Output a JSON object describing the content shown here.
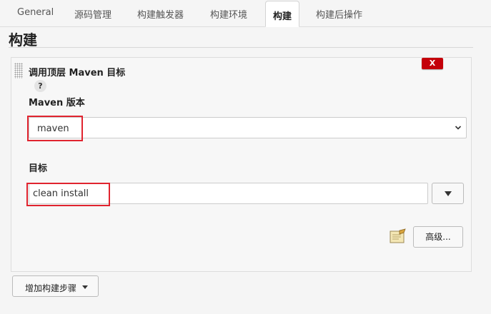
{
  "tabs": [
    {
      "label": "General"
    },
    {
      "label": "源码管理"
    },
    {
      "label": "构建触发器"
    },
    {
      "label": "构建环境"
    },
    {
      "label": "构建",
      "active": true
    },
    {
      "label": "构建后操作"
    }
  ],
  "section": {
    "title": "构建"
  },
  "build_step": {
    "title": "调用顶层 Maven 目标",
    "delete_label": "X",
    "help_label": "?",
    "maven_version": {
      "label": "Maven 版本",
      "selected": "maven"
    },
    "goals": {
      "label": "目标",
      "value": "clean install"
    },
    "advanced_label": "高级..."
  },
  "add_step_label": "增加构建步骤",
  "colors": {
    "delete_red": "#c4000a",
    "highlight_red": "#e0242f",
    "active_tab_bg": "#ffffff"
  },
  "icons": [
    "help-icon",
    "chevron-down-icon",
    "notepad-icon",
    "caret-down-icon",
    "drag-handle-icon"
  ]
}
